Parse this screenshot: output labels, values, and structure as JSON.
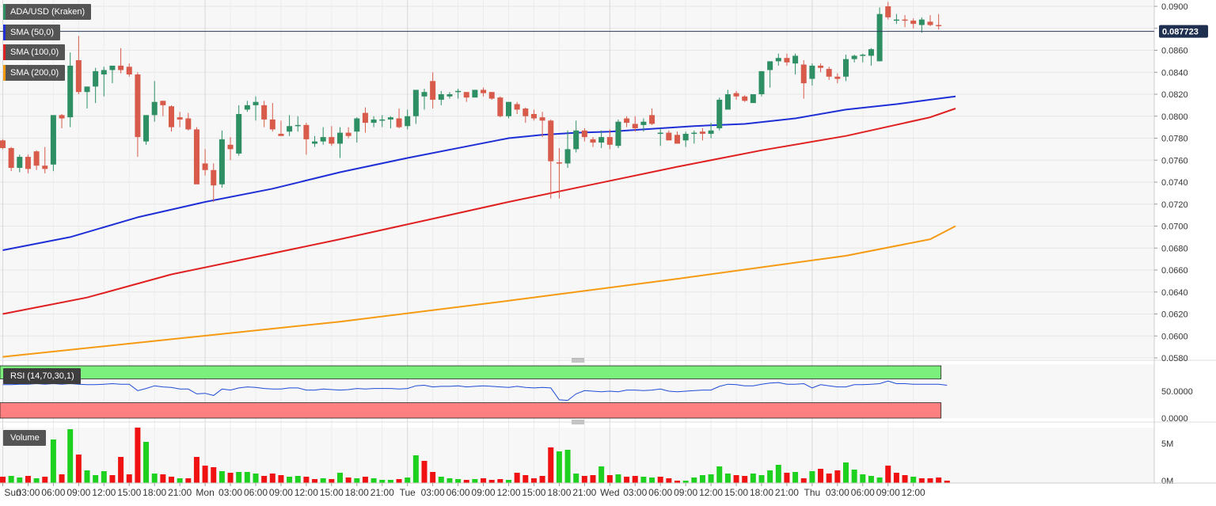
{
  "pair_label": "ADA/USD (Kraken)",
  "indicators": [
    {
      "label": "SMA (50,0)",
      "color": "#1f2fd6"
    },
    {
      "label": "SMA (100,0)",
      "color": "#e02020"
    },
    {
      "label": "SMA (200,0)",
      "color": "#f59a12"
    }
  ],
  "rsi_label": "RSI (14,70,30,1)",
  "volume_label": "Volume",
  "last_price_label": "0.087723",
  "colors": {
    "up": "#2e8f64",
    "down": "#d85a4a",
    "vol_up": "#1fd11f",
    "vol_down": "#f01212",
    "rsi_line": "#1f4bd6",
    "rsi_over": "#7cf07c",
    "rsi_under": "#ff8080",
    "grid": "#e6e6e6",
    "bg": "#f7f7f7"
  },
  "chart_data": {
    "type": "candlestick",
    "interval_hours": 1,
    "price_axis": {
      "ylim": [
        0.058,
        0.09
      ],
      "ticks": [
        "0.0580",
        "0.0600",
        "0.0620",
        "0.0640",
        "0.0660",
        "0.0680",
        "0.0700",
        "0.0720",
        "0.0740",
        "0.0760",
        "0.0780",
        "0.0800",
        "0.0820",
        "0.0840",
        "0.0860",
        "0.0880",
        "0.0900"
      ]
    },
    "x_labels": [
      {
        "label": "Sun",
        "h": 0
      },
      {
        "label": "03:00",
        "h": 3
      },
      {
        "label": "06:00",
        "h": 6
      },
      {
        "label": "09:00",
        "h": 9
      },
      {
        "label": "12:00",
        "h": 12
      },
      {
        "label": "15:00",
        "h": 15
      },
      {
        "label": "18:00",
        "h": 18
      },
      {
        "label": "21:00",
        "h": 21
      },
      {
        "label": "Mon",
        "h": 24
      },
      {
        "label": "03:00",
        "h": 27
      },
      {
        "label": "06:00",
        "h": 30
      },
      {
        "label": "09:00",
        "h": 33
      },
      {
        "label": "12:00",
        "h": 36
      },
      {
        "label": "15:00",
        "h": 39
      },
      {
        "label": "18:00",
        "h": 42
      },
      {
        "label": "21:00",
        "h": 45
      },
      {
        "label": "Tue",
        "h": 48
      },
      {
        "label": "03:00",
        "h": 51
      },
      {
        "label": "06:00",
        "h": 54
      },
      {
        "label": "09:00",
        "h": 57
      },
      {
        "label": "12:00",
        "h": 60
      },
      {
        "label": "15:00",
        "h": 63
      },
      {
        "label": "18:00",
        "h": 66
      },
      {
        "label": "21:00",
        "h": 69
      },
      {
        "label": "Wed",
        "h": 72
      },
      {
        "label": "03:00",
        "h": 75
      },
      {
        "label": "06:00",
        "h": 78
      },
      {
        "label": "09:00",
        "h": 81
      },
      {
        "label": "12:00",
        "h": 84
      },
      {
        "label": "15:00",
        "h": 87
      },
      {
        "label": "18:00",
        "h": 90
      },
      {
        "label": "21:00",
        "h": 93
      },
      {
        "label": "Thu",
        "h": 96
      },
      {
        "label": "03:00",
        "h": 99
      },
      {
        "label": "06:00",
        "h": 102
      },
      {
        "label": "09:00",
        "h": 105
      },
      {
        "label": "12:00",
        "h": 108
      }
    ],
    "candles": [
      [
        0.0778,
        0.0779,
        0.077,
        0.0771
      ],
      [
        0.0771,
        0.0772,
        0.075,
        0.0753
      ],
      [
        0.0753,
        0.0765,
        0.0749,
        0.0763
      ],
      [
        0.0763,
        0.0765,
        0.0748,
        0.0752
      ],
      [
        0.0768,
        0.0769,
        0.0751,
        0.0755
      ],
      [
        0.0755,
        0.0772,
        0.0748,
        0.0752
      ],
      [
        0.0756,
        0.08,
        0.075,
        0.0801
      ],
      [
        0.0801,
        0.0802,
        0.0789,
        0.0798
      ],
      [
        0.0799,
        0.0858,
        0.079,
        0.0846
      ],
      [
        0.0851,
        0.0873,
        0.082,
        0.0822
      ],
      [
        0.0822,
        0.0826,
        0.0807,
        0.0827
      ],
      [
        0.0827,
        0.0844,
        0.0812,
        0.0841
      ],
      [
        0.0838,
        0.0845,
        0.0818,
        0.0842
      ],
      [
        0.0842,
        0.0844,
        0.083,
        0.0846
      ],
      [
        0.0846,
        0.0862,
        0.0839,
        0.0842
      ],
      [
        0.0845,
        0.0848,
        0.0836,
        0.0838
      ],
      [
        0.0838,
        0.084,
        0.0763,
        0.0781
      ],
      [
        0.0777,
        0.0801,
        0.0774,
        0.0801
      ],
      [
        0.0801,
        0.0832,
        0.0795,
        0.0813
      ],
      [
        0.0814,
        0.0814,
        0.08,
        0.081
      ],
      [
        0.0809,
        0.081,
        0.0786,
        0.079
      ],
      [
        0.0799,
        0.0804,
        0.079,
        0.0797
      ],
      [
        0.0798,
        0.0803,
        0.0787,
        0.0788
      ],
      [
        0.0788,
        0.079,
        0.0741,
        0.0738
      ],
      [
        0.0757,
        0.077,
        0.0746,
        0.0751
      ],
      [
        0.0751,
        0.0757,
        0.0722,
        0.0737
      ],
      [
        0.0738,
        0.0787,
        0.0735,
        0.0779
      ],
      [
        0.0774,
        0.0781,
        0.076,
        0.077
      ],
      [
        0.0766,
        0.081,
        0.0764,
        0.0802
      ],
      [
        0.0806,
        0.0814,
        0.0804,
        0.081
      ],
      [
        0.081,
        0.0818,
        0.0796,
        0.0813
      ],
      [
        0.081,
        0.0814,
        0.079,
        0.0797
      ],
      [
        0.0797,
        0.0812,
        0.0786,
        0.0788
      ],
      [
        0.0784,
        0.0796,
        0.0782,
        0.0782
      ],
      [
        0.0786,
        0.0801,
        0.0782,
        0.0791
      ],
      [
        0.0791,
        0.08,
        0.0786,
        0.0792
      ],
      [
        0.0792,
        0.0794,
        0.0765,
        0.0779
      ],
      [
        0.0775,
        0.0782,
        0.0772,
        0.0777
      ],
      [
        0.0777,
        0.079,
        0.0774,
        0.0781
      ],
      [
        0.0781,
        0.0791,
        0.0773,
        0.0775
      ],
      [
        0.0775,
        0.079,
        0.0762,
        0.0785
      ],
      [
        0.0785,
        0.079,
        0.078,
        0.0782
      ],
      [
        0.0786,
        0.0799,
        0.0776,
        0.0798
      ],
      [
        0.0803,
        0.0808,
        0.0785,
        0.0794
      ],
      [
        0.0794,
        0.08,
        0.079,
        0.0797
      ],
      [
        0.0796,
        0.0801,
        0.079,
        0.0797
      ],
      [
        0.0797,
        0.08,
        0.0789,
        0.0799
      ],
      [
        0.0798,
        0.0807,
        0.0789,
        0.079
      ],
      [
        0.0791,
        0.0806,
        0.0788,
        0.08
      ],
      [
        0.08,
        0.0816,
        0.0793,
        0.0824
      ],
      [
        0.0818,
        0.0825,
        0.0806,
        0.0822
      ],
      [
        0.0832,
        0.084,
        0.0807,
        0.0815
      ],
      [
        0.0815,
        0.0823,
        0.081,
        0.082
      ],
      [
        0.0818,
        0.0822,
        0.0816,
        0.082
      ],
      [
        0.0822,
        0.0825,
        0.0816,
        0.0823
      ],
      [
        0.0822,
        0.0822,
        0.0813,
        0.0817
      ],
      [
        0.0817,
        0.0824,
        0.0818,
        0.0824
      ],
      [
        0.0824,
        0.0826,
        0.0818,
        0.0821
      ],
      [
        0.0822,
        0.0822,
        0.0815,
        0.0816
      ],
      [
        0.0817,
        0.0818,
        0.0799,
        0.08
      ],
      [
        0.08,
        0.0813,
        0.0798,
        0.0813
      ],
      [
        0.0811,
        0.0813,
        0.0802,
        0.0806
      ],
      [
        0.0807,
        0.0808,
        0.0794,
        0.08
      ],
      [
        0.0802,
        0.0806,
        0.0796,
        0.0798
      ],
      [
        0.0799,
        0.0804,
        0.0781,
        0.0796
      ],
      [
        0.0796,
        0.0797,
        0.0725,
        0.0759
      ],
      [
        0.0758,
        0.0771,
        0.0725,
        0.0757
      ],
      [
        0.0757,
        0.0787,
        0.0753,
        0.077
      ],
      [
        0.077,
        0.0796,
        0.0767,
        0.0787
      ],
      [
        0.0787,
        0.0789,
        0.0777,
        0.0781
      ],
      [
        0.0779,
        0.0781,
        0.0772,
        0.0776
      ],
      [
        0.0776,
        0.0787,
        0.0771,
        0.0781
      ],
      [
        0.0781,
        0.0788,
        0.077,
        0.0774
      ],
      [
        0.0773,
        0.0797,
        0.0771,
        0.0795
      ],
      [
        0.0798,
        0.08,
        0.079,
        0.0794
      ],
      [
        0.0793,
        0.08,
        0.0786,
        0.0789
      ],
      [
        0.0792,
        0.0798,
        0.0786,
        0.0795
      ],
      [
        0.0801,
        0.0807,
        0.0792,
        0.0793
      ],
      [
        0.0785,
        0.0789,
        0.0773,
        0.0785
      ],
      [
        0.0785,
        0.0787,
        0.0779,
        0.0778
      ],
      [
        0.0783,
        0.0786,
        0.0778,
        0.0775
      ],
      [
        0.0778,
        0.0786,
        0.0772,
        0.0784
      ],
      [
        0.0784,
        0.0787,
        0.0775,
        0.0785
      ],
      [
        0.0786,
        0.0789,
        0.0778,
        0.0784
      ],
      [
        0.0784,
        0.0794,
        0.078,
        0.0787
      ],
      [
        0.0789,
        0.0817,
        0.0787,
        0.0815
      ],
      [
        0.0806,
        0.0824,
        0.0808,
        0.082
      ],
      [
        0.0821,
        0.0823,
        0.0815,
        0.0818
      ],
      [
        0.0818,
        0.0819,
        0.0813,
        0.0814
      ],
      [
        0.0812,
        0.082,
        0.0812,
        0.082
      ],
      [
        0.082,
        0.0836,
        0.0818,
        0.0841
      ],
      [
        0.0842,
        0.0847,
        0.0826,
        0.085
      ],
      [
        0.085,
        0.0857,
        0.0846,
        0.0853
      ],
      [
        0.0853,
        0.0857,
        0.0846,
        0.0849
      ],
      [
        0.0848,
        0.0857,
        0.0838,
        0.0855
      ],
      [
        0.0847,
        0.0851,
        0.0816,
        0.083
      ],
      [
        0.0834,
        0.0848,
        0.0828,
        0.0846
      ],
      [
        0.0846,
        0.0848,
        0.084,
        0.0844
      ],
      [
        0.0843,
        0.0845,
        0.0833,
        0.0836
      ],
      [
        0.0836,
        0.0839,
        0.083,
        0.0834
      ],
      [
        0.0836,
        0.0856,
        0.0832,
        0.0852
      ],
      [
        0.0852,
        0.0856,
        0.0849,
        0.0855
      ],
      [
        0.0855,
        0.0857,
        0.0849,
        0.0856
      ],
      [
        0.0855,
        0.0862,
        0.0846,
        0.0861
      ],
      [
        0.085,
        0.0899,
        0.085,
        0.0893
      ],
      [
        0.09,
        0.0904,
        0.0888,
        0.089
      ],
      [
        0.0888,
        0.0893,
        0.0884,
        0.0888
      ],
      [
        0.0888,
        0.0892,
        0.0881,
        0.0887
      ],
      [
        0.0887,
        0.0889,
        0.088,
        0.0884
      ],
      [
        0.0883,
        0.089,
        0.0876,
        0.0888
      ],
      [
        0.0886,
        0.0892,
        0.0882,
        0.0883
      ],
      [
        0.0883,
        0.0893,
        0.0879,
        0.0882
      ]
    ],
    "sma50": [
      [
        0,
        0.0678
      ],
      [
        8,
        0.069
      ],
      [
        16,
        0.0708
      ],
      [
        24,
        0.0722
      ],
      [
        32,
        0.0734
      ],
      [
        40,
        0.0749
      ],
      [
        48,
        0.0762
      ],
      [
        56,
        0.0774
      ],
      [
        60,
        0.078
      ],
      [
        64,
        0.0783
      ],
      [
        68,
        0.0785
      ],
      [
        72,
        0.0786
      ],
      [
        76,
        0.0788
      ],
      [
        82,
        0.0791
      ],
      [
        88,
        0.0793
      ],
      [
        94,
        0.0798
      ],
      [
        100,
        0.0806
      ],
      [
        106,
        0.0811
      ],
      [
        110,
        0.0815
      ],
      [
        113,
        0.0818
      ]
    ],
    "sma100": [
      [
        0,
        0.062
      ],
      [
        10,
        0.0635
      ],
      [
        20,
        0.0656
      ],
      [
        30,
        0.0672
      ],
      [
        40,
        0.0688
      ],
      [
        50,
        0.0705
      ],
      [
        60,
        0.0722
      ],
      [
        70,
        0.0738
      ],
      [
        80,
        0.0754
      ],
      [
        90,
        0.0769
      ],
      [
        100,
        0.0782
      ],
      [
        110,
        0.0799
      ],
      [
        113,
        0.0807
      ]
    ],
    "sma200": [
      [
        0,
        0.0581
      ],
      [
        20,
        0.0597
      ],
      [
        40,
        0.0613
      ],
      [
        60,
        0.0632
      ],
      [
        80,
        0.0652
      ],
      [
        100,
        0.0673
      ],
      [
        110,
        0.0688
      ],
      [
        113,
        0.07
      ]
    ],
    "rsi": {
      "ylim": [
        0,
        100
      ],
      "ticks": [
        "0.0000",
        "50.0000"
      ],
      "overbought": 70,
      "oversold": 30,
      "values": [
        62,
        62,
        63,
        63,
        64,
        63,
        64,
        63,
        64,
        63,
        62,
        62,
        63,
        64,
        63,
        63,
        51,
        55,
        60,
        58,
        57,
        54,
        54,
        45,
        46,
        42,
        54,
        52,
        56,
        58,
        57,
        55,
        54,
        54,
        56,
        56,
        52,
        52,
        54,
        53,
        52,
        53,
        55,
        54,
        55,
        55,
        55,
        54,
        55,
        60,
        61,
        58,
        59,
        59,
        60,
        58,
        59,
        60,
        59,
        58,
        57,
        59,
        57,
        56,
        57,
        56,
        34,
        33,
        45,
        51,
        50,
        49,
        50,
        49,
        52,
        52,
        51,
        52,
        54,
        50,
        49,
        50,
        51,
        52,
        52,
        59,
        63,
        62,
        60,
        60,
        63,
        65,
        66,
        63,
        63,
        64,
        56,
        62,
        60,
        58,
        58,
        62,
        62,
        63,
        64,
        69,
        64,
        64,
        63,
        63,
        63,
        63,
        61
      ]
    },
    "volume": {
      "ylim": [
        0,
        7
      ],
      "ticks": [
        "0M",
        "5M"
      ],
      "values": [
        0.8,
        0.9,
        0.7,
        0.9,
        0.6,
        0.8,
        5.5,
        1.1,
        6.8,
        3.6,
        1.6,
        1.0,
        1.5,
        1.0,
        3.3,
        1.1,
        7.0,
        5.2,
        1.2,
        1.1,
        0.8,
        0.6,
        0.6,
        3.3,
        2.2,
        2.0,
        1.5,
        1.3,
        1.4,
        1.4,
        1.2,
        0.9,
        1.2,
        1.0,
        0.8,
        0.9,
        0.8,
        0.5,
        0.6,
        0.5,
        1.3,
        0.7,
        0.6,
        0.8,
        0.6,
        0.4,
        0.4,
        0.5,
        0.7,
        3.5,
        2.8,
        1.4,
        0.8,
        0.6,
        0.5,
        0.4,
        0.5,
        0.6,
        0.4,
        0.5,
        0.4,
        1.3,
        1.0,
        0.6,
        0.9,
        4.5,
        4.0,
        4.2,
        1.2,
        0.9,
        1.0,
        2.1,
        1.0,
        1.1,
        0.8,
        0.9,
        0.8,
        0.7,
        0.8,
        0.6,
        0.3,
        0.3,
        0.7,
        1.0,
        1.1,
        2.1,
        1.2,
        1.0,
        0.9,
        1.2,
        1.0,
        1.6,
        2.3,
        1.3,
        1.4,
        0.6,
        1.5,
        1.8,
        1.2,
        1.6,
        2.6,
        1.7,
        1.1,
        0.9,
        0.7,
        2.2,
        1.3,
        1.0,
        0.8,
        0.6,
        0.6,
        0.7,
        0.3
      ],
      "up_flags": [
        0,
        1,
        1,
        0,
        1,
        0,
        1,
        0,
        1,
        0,
        1,
        1,
        1,
        0,
        0,
        0,
        0,
        1,
        1,
        0,
        0,
        1,
        0,
        0,
        0,
        0,
        1,
        0,
        1,
        1,
        1,
        0,
        0,
        0,
        1,
        1,
        0,
        0,
        1,
        0,
        1,
        0,
        1,
        0,
        1,
        1,
        1,
        0,
        1,
        1,
        0,
        0,
        1,
        1,
        1,
        0,
        1,
        0,
        0,
        0,
        1,
        0,
        0,
        0,
        0,
        0,
        1,
        1,
        1,
        0,
        0,
        1,
        0,
        1,
        0,
        0,
        1,
        1,
        0,
        0,
        0,
        1,
        1,
        1,
        1,
        1,
        1,
        0,
        0,
        1,
        1,
        1,
        1,
        0,
        1,
        0,
        1,
        0,
        0,
        0,
        1,
        1,
        1,
        1,
        1,
        0,
        0,
        0,
        1,
        0,
        0,
        0,
        0
      ]
    }
  }
}
